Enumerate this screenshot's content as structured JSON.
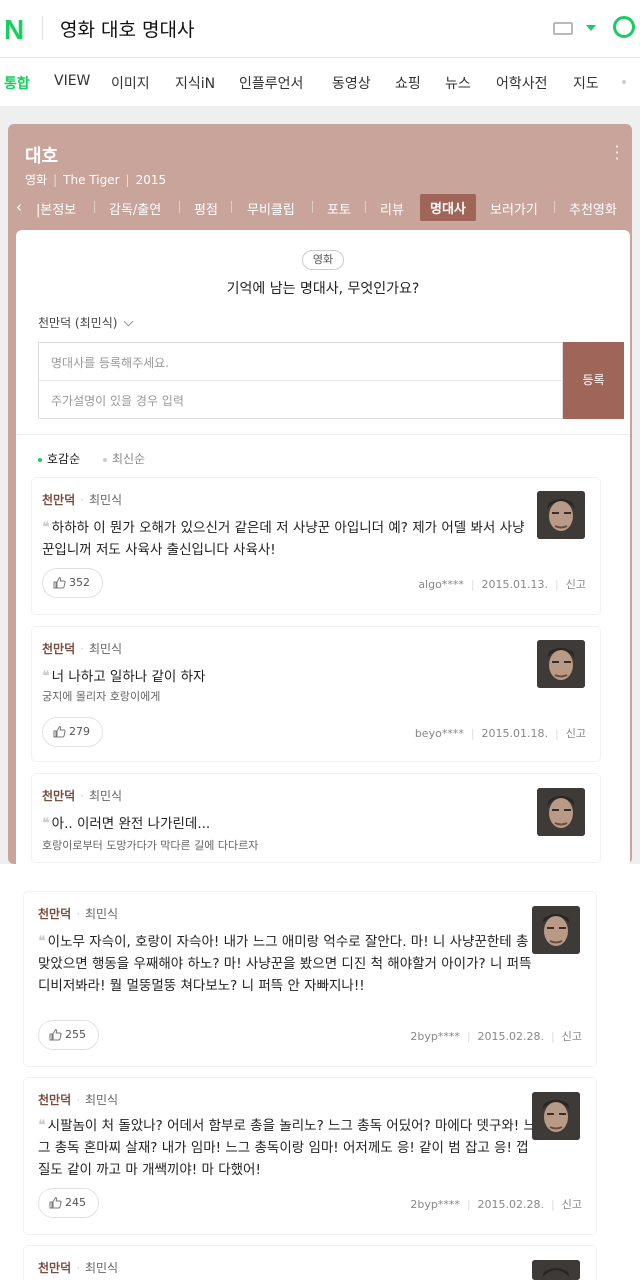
{
  "header": {
    "logo": "N",
    "query": "영화 대호 명대사"
  },
  "nav": {
    "tabs": [
      "통합",
      "VIEW",
      "이미지",
      "지식iN",
      "인플루언서",
      "동영상",
      "쇼핑",
      "뉴스",
      "어학사전",
      "지도"
    ],
    "active": "통합"
  },
  "movie": {
    "title": "대호",
    "meta": [
      "영화",
      "The Tiger",
      "2015"
    ],
    "subtabs": [
      "|본정보",
      "감독/출연",
      "평점",
      "무비클립",
      "포토",
      "리뷰",
      "명대사",
      "보러가기",
      "추천영화"
    ],
    "active_subtab": "명대사"
  },
  "panel": {
    "genre": "영화",
    "question": "기억에 남는 명대사, 무엇인가요?",
    "character_select": "천만덕 (최민식)",
    "input_placeholder": "명대사를 등록해주세요.",
    "desc_placeholder": "주가설명이 있을 경우 입력",
    "register_label": "등록",
    "sort_options": [
      "호감순",
      "최신순"
    ],
    "active_sort": "호감순"
  },
  "quotes": [
    {
      "character": "천만덕",
      "actor": "최민식",
      "text": "하하하 이 뭔가 오해가 있으신거 같은데 저 사냥꾼 아입니더 예? 제가 어델 봐서 사냥꾼입니꺼 저도 사육사 출신입니다 사육사!",
      "sub": "",
      "likes": "352",
      "user": "algo****",
      "date": "2015.01.13.",
      "report": "신고"
    },
    {
      "character": "천만덕",
      "actor": "최민식",
      "text": "너 나하고 일하나 같이 하자",
      "sub": "궁지에 몰리자 호랑이에게",
      "likes": "279",
      "user": "beyo****",
      "date": "2015.01.18.",
      "report": "신고"
    },
    {
      "character": "천만덕",
      "actor": "최민식",
      "text": "아.. 이러면 완전 나가린데...",
      "sub": "호랑이로부터 도망가다가 막다른 길에 다다르자",
      "likes": "",
      "user": "",
      "date": "",
      "report": ""
    },
    {
      "character": "천만덕",
      "actor": "최민식",
      "text": "이노무 자슥이, 호랑이 자슥아! 내가 느그 애미랑 억수로 잘안다. 마! 니 사냥꾼한테 총 맞았으면 행동을 우째해야 하노? 마! 사냥꾼을 봤으면 디진 척 해야할거 아이가? 니 퍼뜩 디비저봐라! 뭘 멀뚱멀뚱 쳐다보노? 니 퍼뜩 안 자빠지나!!",
      "sub": "",
      "likes": "255",
      "user": "2byp****",
      "date": "2015.02.28.",
      "report": "신고"
    },
    {
      "character": "천만덕",
      "actor": "최민식",
      "text": "시팔놈이 처 돌았나? 어데서 함부로 총을 놀리노? 느그 총독 어딨어? 마에다 뎃구와! 느그 총독 혼마찌 살재? 내가 임마! 느그 총독이랑 임마! 어저께도 응! 같이 범 잡고 응! 껍질도 같이 까고 마 개쌕끼야! 마 다했어!",
      "sub": "",
      "likes": "245",
      "user": "2byp****",
      "date": "2015.02.28.",
      "report": "신고"
    },
    {
      "character": "천만덕",
      "actor": "최민식",
      "text": "",
      "sub": "",
      "likes": "",
      "user": "",
      "date": "",
      "report": ""
    }
  ],
  "colors": {
    "brand": "#19ce60",
    "card_bg": "#c9a49a",
    "accent": "#9f6558"
  }
}
